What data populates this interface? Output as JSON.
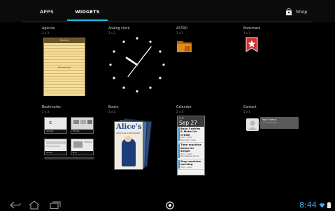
{
  "tabs": [
    {
      "label": "APPS",
      "selected": false
    },
    {
      "label": "WIDGETS",
      "selected": true
    }
  ],
  "shop": {
    "label": "Shop",
    "icon": "shopping-bag-icon"
  },
  "widgets": [
    {
      "title": "Agenda",
      "size": "2 x 3"
    },
    {
      "title": "Analog clock",
      "size": "2 x 2"
    },
    {
      "title": "ASTRO",
      "size": "1 x 1"
    },
    {
      "title": "Bookmark",
      "size": "1 x 1"
    },
    {
      "title": "Bookmarks",
      "size": "3 x 3"
    },
    {
      "title": "Books",
      "size": "2 x 2"
    },
    {
      "title": "Calendar",
      "size": "2 x 3"
    },
    {
      "title": "Contact",
      "size": "1 x 1"
    }
  ],
  "agenda_preview": {
    "header": "Events",
    "empty_text": "No events"
  },
  "bookmarks_preview": {
    "thumbs": [
      {
        "label": "Google"
      },
      {
        "label": "Picasa"
      },
      {
        "label": "Gmail"
      },
      {
        "label": "NYT"
      }
    ]
  },
  "books_preview": {
    "cover_title": "Alice's",
    "cover_subtitle": "Adventures in Wonderland"
  },
  "calendar_preview": {
    "day_of_week": "TUE",
    "date": "Sep 27",
    "events": [
      {
        "title": "Bake Cookies & Make Ice Cream",
        "time": "2pm – 3pm",
        "place": "Mountain View"
      },
      {
        "title": "Time machine demo for Sergei",
        "time": "3pm – 5pm",
        "place": "Blue Palace Room"
      },
      {
        "title": "Stop machine uprising",
        "time": "5pm – 6pm",
        "place": ""
      }
    ]
  },
  "contact_preview": {
    "name": "Your Friend",
    "subtitle": "1 unread mail"
  },
  "status": {
    "time": "8:44"
  },
  "colors": {
    "accent": "#33b5e5",
    "background": "#000000",
    "bookmark_red": "#d32f2f",
    "folder_orange": "#e08a1a"
  }
}
